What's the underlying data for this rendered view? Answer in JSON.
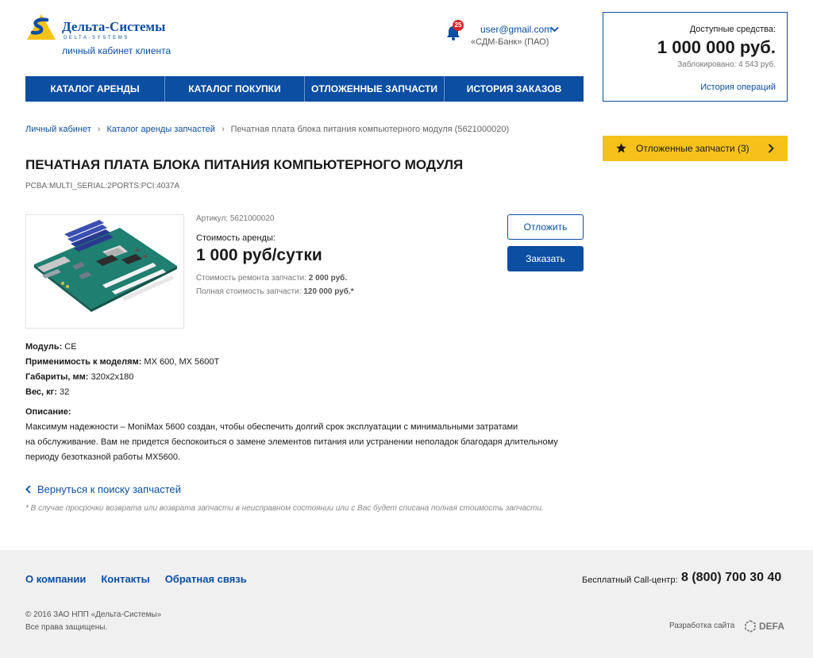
{
  "logo": {
    "title": "Дельта-Системы",
    "subtitle": "DELTA-SYSTEMS",
    "tagline": "личный кабинет клиента"
  },
  "user": {
    "notifications_count": "25",
    "email": "user@gmail.com",
    "bank": "«СДМ-Банк» (ПАО)"
  },
  "nav": {
    "items": [
      {
        "label": "КАТАЛОГ АРЕНДЫ"
      },
      {
        "label": "КАТАЛОГ ПОКУПКИ"
      },
      {
        "label": "ОТЛОЖЕННЫЕ ЗАПЧАСТИ"
      },
      {
        "label": "ИСТОРИЯ ЗАКАЗОВ"
      }
    ]
  },
  "balance": {
    "label": "Доступные средства:",
    "amount": "1 000 000 руб.",
    "blocked": "Заблокировано: 4 543 руб.",
    "history_link": "История операций"
  },
  "deferred": {
    "label": "Отложенные запчасти (3)"
  },
  "breadcrumb": {
    "items": [
      {
        "label": "Личный кабинет"
      },
      {
        "label": "Каталог аренды запчастей"
      },
      {
        "label": "Печатная плата блока питания компьютерного модуля (5621000020)"
      }
    ]
  },
  "product": {
    "title": "ПЕЧАТНАЯ ПЛАТА БЛОКА ПИТАНИЯ КОМПЬЮТЕРНОГО МОДУЛЯ",
    "code": "PCBA:MULTI_SERIAL:2PORTS:PCI:4037A",
    "article": "Артикул: 5621000020",
    "rent_label": "Стоимость аренды:",
    "rent_price": "1 000 руб/сутки",
    "repair_label": "Стоимость ремонта запчасти: ",
    "repair_value": "2 000 руб.",
    "full_label": "Полная стоимость запчасти: ",
    "full_value": "120 000 руб.*",
    "defer_button": "Отложить",
    "order_button": "Заказать"
  },
  "specs": [
    {
      "label": "Модуль:",
      "value": " CE"
    },
    {
      "label": "Применимость к моделям:",
      "value": " MX 600, MX 5600T"
    },
    {
      "label": "Габариты, мм:",
      "value": " 320x2x180"
    },
    {
      "label": "Вес, кг:",
      "value": " 32"
    }
  ],
  "description": {
    "heading": "Описание:",
    "line1": "Максимум надежности – MoniMax 5600 создан, чтобы обеспечить долгий срок эксплуатации с минимальными затратами",
    "line2": "на обслуживание. Вам не придется беспокоиться о замене элементов питания или устранении неполадок благодаря длительному",
    "line3": "периоду безотказной работы MX5600."
  },
  "back_link": "Вернуться к поиску запчастей",
  "footnote": "* В случае просрочки возврата или возврата запчасти в неисправном состоянии или с Вас будет списана полная стоимость запчасти.",
  "footer": {
    "links": [
      {
        "label": "О компании"
      },
      {
        "label": "Контакты"
      },
      {
        "label": "Обратная связь"
      }
    ],
    "call_label": "Бесплатный Call-центр:",
    "phone": "8 (800) 700 30 40",
    "copyright": "© 2016 ЗАО НПП «Дельта-Системы»",
    "rights": "Все права защищены.",
    "dev_label": "Разработка сайта",
    "dev_brand": "DEFA"
  },
  "colors": {
    "brand_blue": "#0b4ea2",
    "accent_yellow": "#f6c21a",
    "badge_red": "#d8252a",
    "footer_bg": "#f0f0f1"
  }
}
